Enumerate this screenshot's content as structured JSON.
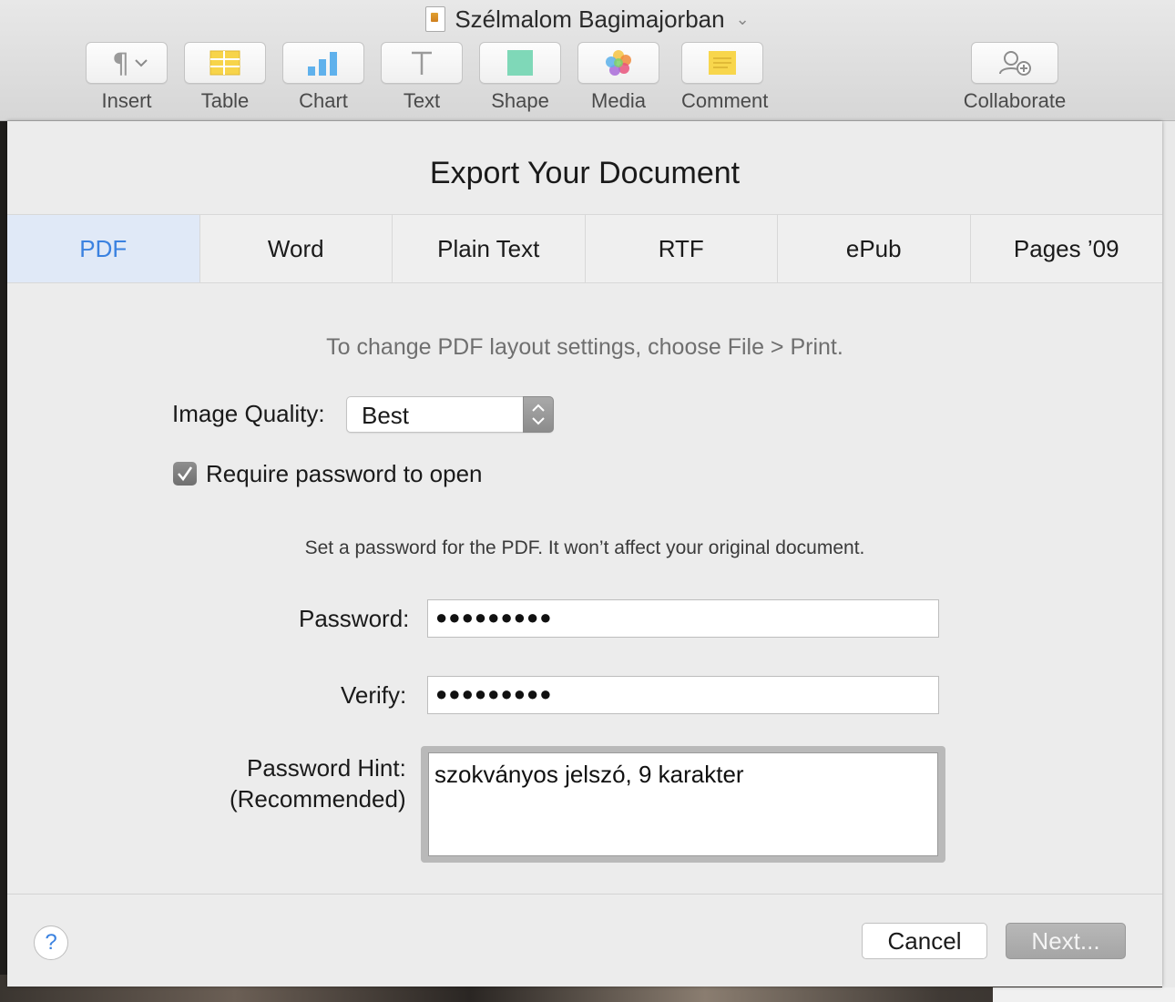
{
  "window": {
    "title": "Szélmalom Bagimajorban"
  },
  "toolbar": {
    "items": [
      {
        "label": "Insert",
        "icon": "paragraph-icon"
      },
      {
        "label": "Table",
        "icon": "table-icon"
      },
      {
        "label": "Chart",
        "icon": "chart-icon"
      },
      {
        "label": "Text",
        "icon": "text-icon"
      },
      {
        "label": "Shape",
        "icon": "shape-icon"
      },
      {
        "label": "Media",
        "icon": "media-icon"
      },
      {
        "label": "Comment",
        "icon": "comment-icon"
      },
      {
        "label": "Collaborate",
        "icon": "collaborate-icon"
      }
    ]
  },
  "dialog": {
    "title": "Export Your Document",
    "tabs": [
      {
        "label": "PDF",
        "active": true
      },
      {
        "label": "Word",
        "active": false
      },
      {
        "label": "Plain Text",
        "active": false
      },
      {
        "label": "RTF",
        "active": false
      },
      {
        "label": "ePub",
        "active": false
      },
      {
        "label": "Pages ’09",
        "active": false
      }
    ],
    "layout_hint": "To change PDF layout settings, choose File > Print.",
    "image_quality": {
      "label": "Image Quality:",
      "value": "Best"
    },
    "require_password": {
      "label": "Require password to open",
      "checked": true
    },
    "password_info": "Set a password for the PDF. It won’t affect your original document.",
    "password": {
      "label": "Password:",
      "value": "●●●●●●●●●"
    },
    "verify": {
      "label": "Verify:",
      "value": "●●●●●●●●●"
    },
    "password_hint": {
      "label_line1": "Password Hint:",
      "label_line2": "(Recommended)",
      "value": "szokványos jelszó, 9 karakter"
    },
    "help_label": "?",
    "cancel_label": "Cancel",
    "next_label": "Next..."
  },
  "colors": {
    "accent": "#3b82e0",
    "active_tab_bg": "#e0e9f7"
  }
}
